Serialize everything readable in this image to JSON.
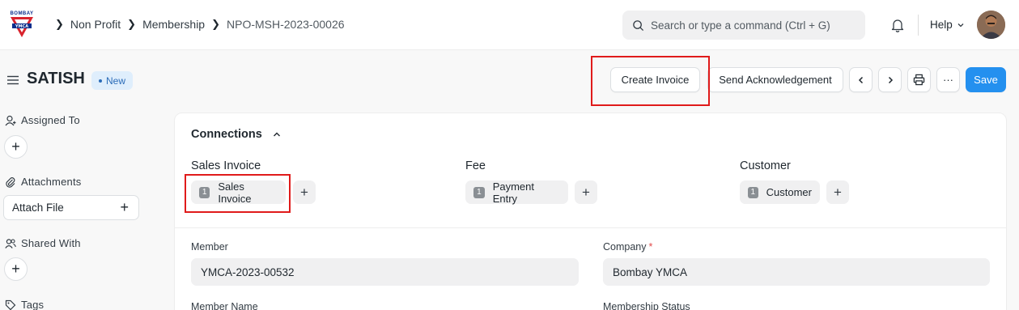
{
  "navbar": {
    "logo_text": "BOMBAY",
    "breadcrumbs": [
      "Non Profit",
      "Membership",
      "NPO-MSH-2023-00026"
    ],
    "search_placeholder": "Search or type a command (Ctrl + G)",
    "help_label": "Help"
  },
  "header": {
    "title": "SATISH",
    "status": "New",
    "buttons": {
      "create_invoice": "Create Invoice",
      "send_ack": "Send Acknowledgement",
      "more": "···",
      "save": "Save"
    }
  },
  "sidebar": {
    "assigned_to": "Assigned To",
    "attachments": "Attachments",
    "attach_file": "Attach File",
    "shared_with": "Shared With",
    "tags": "Tags"
  },
  "connections": {
    "title": "Connections",
    "groups": [
      {
        "title": "Sales Invoice",
        "item": "Sales Invoice",
        "count": "1"
      },
      {
        "title": "Fee",
        "item": "Payment Entry",
        "count": "1"
      },
      {
        "title": "Customer",
        "item": "Customer",
        "count": "1"
      }
    ]
  },
  "form": {
    "member_label": "Member",
    "member_value": "YMCA-2023-00532",
    "company_label": "Company",
    "company_required": "*",
    "company_value": "Bombay YMCA",
    "member_name_label": "Member Name",
    "membership_status_label": "Membership Status"
  },
  "colors": {
    "primary": "#2490ef",
    "highlight": "#e01b1b",
    "badge_bg": "#dfeefc"
  }
}
